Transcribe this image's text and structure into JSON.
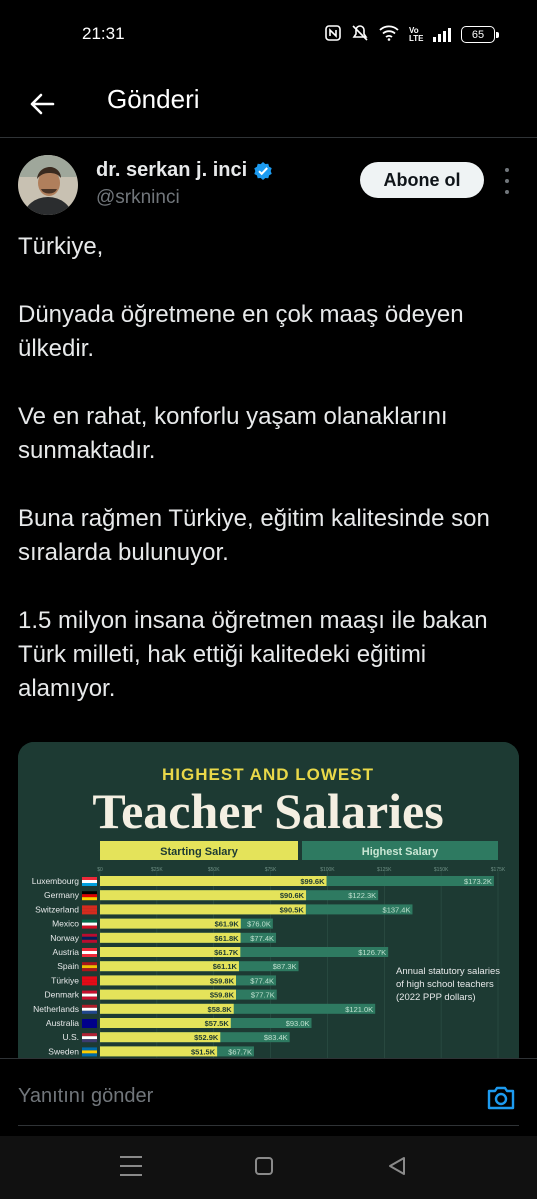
{
  "status_bar": {
    "time": "21:31",
    "volte": "Vo LTE",
    "battery": "65",
    "icons": [
      "nfc-icon",
      "mute-icon",
      "wifi-icon",
      "volte-icon",
      "signal-icon",
      "battery-icon"
    ]
  },
  "header": {
    "title": "Gönderi",
    "back_icon": "arrow-left-icon"
  },
  "post": {
    "author_name": "dr. serkan j. inci",
    "author_handle": "@srkninci",
    "verified_icon": "verified-badge-icon",
    "follow_label": "Abone ol",
    "more_icon": "more-vertical-icon",
    "paragraphs": [
      "Türkiye,",
      "Dünyada öğretmene en çok maaş ödeyen ülkedir.",
      "Ve en rahat, konforlu yaşam olanaklarını sunmaktadır.",
      "Buna rağmen Türkiye, eğitim kalitesinde son sıralarda bulunuyor.",
      "1.5 milyon insana öğretmen maaşı ile bakan Türk milleti, hak ettiği kalitedeki eğitimi alamıyor."
    ]
  },
  "chart_data": {
    "type": "bar",
    "supertitle": "HIGHEST AND LOWEST",
    "title": "Teacher Salaries",
    "legend": [
      "Starting Salary",
      "Highest Salary"
    ],
    "annotation": [
      "Annual statutory salaries",
      "of high school teachers",
      "(2022 PPP dollars)"
    ],
    "xlim": [
      0,
      175000
    ],
    "ticks": [
      "$0",
      "$25K",
      "$50K",
      "$75K",
      "$100K",
      "$125K",
      "$150K",
      "$175K"
    ],
    "categories": [
      "Luxembourg",
      "Germany",
      "Switzerland",
      "Mexico",
      "Norway",
      "Austria",
      "Spain",
      "Türkiye",
      "Denmark",
      "Netherlands",
      "Australia",
      "U.S.",
      "Sweden"
    ],
    "series": [
      {
        "name": "Starting Salary",
        "values": [
          99600,
          90600,
          90500,
          61900,
          61800,
          61700,
          61100,
          59800,
          59800,
          58800,
          57500,
          52900,
          51500
        ],
        "labels": [
          "$99.6K",
          "$90.6K",
          "$90.5K",
          "$61.9K",
          "$61.8K",
          "$61.7K",
          "$61.1K",
          "$59.8K",
          "$59.8K",
          "$58.8K",
          "$57.5K",
          "$52.9K",
          "$51.5K"
        ]
      },
      {
        "name": "Highest Salary",
        "values": [
          173200,
          122300,
          137400,
          76000,
          77400,
          126700,
          87300,
          77400,
          77700,
          121000,
          93000,
          83400,
          67700
        ],
        "labels": [
          "$173.2K",
          "$122.3K",
          "$137.4K",
          "$76.0K",
          "$77.4K",
          "$126.7K",
          "$87.3K",
          "$77.4K",
          "$77.7K",
          "$121.0K",
          "$93.0K",
          "$83.4K",
          "$67.7K"
        ]
      }
    ],
    "colors": {
      "background": "#1d3a33",
      "starting": "#e4e35a",
      "highest": "#2e7a61",
      "title": "#f4efe2",
      "supertitle": "#e9d849"
    }
  },
  "reply": {
    "placeholder": "Yanıtını gönder",
    "camera_icon": "camera-icon"
  },
  "nav": {
    "icons": [
      "recent-apps-icon",
      "home-icon",
      "back-triangle-icon"
    ]
  }
}
